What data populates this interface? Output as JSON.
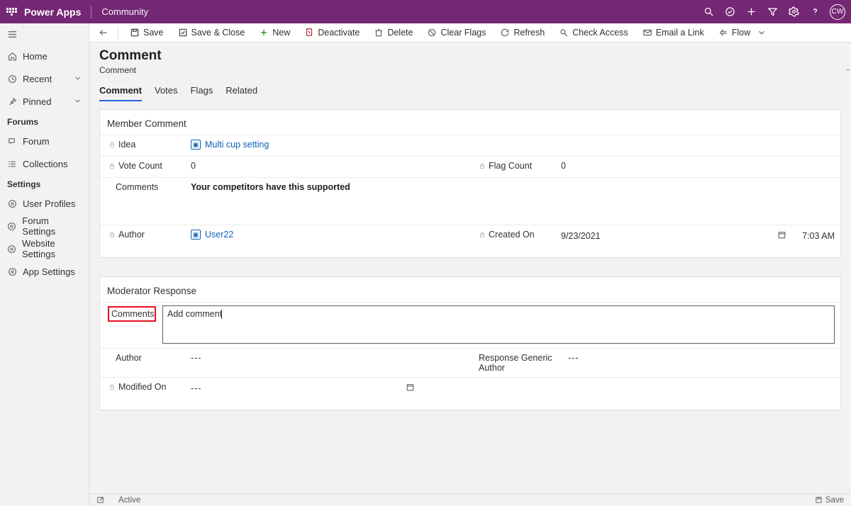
{
  "topbar": {
    "app": "Power Apps",
    "area": "Community",
    "avatar": "CW"
  },
  "sidebar": {
    "home": "Home",
    "recent": "Recent",
    "pinned": "Pinned",
    "group_forums": "Forums",
    "forum": "Forum",
    "collections": "Collections",
    "group_settings": "Settings",
    "user_profiles": "User Profiles",
    "forum_settings": "Forum Settings",
    "website_settings": "Website Settings",
    "app_settings": "App Settings"
  },
  "commands": {
    "save": "Save",
    "save_close": "Save & Close",
    "new": "New",
    "deactivate": "Deactivate",
    "delete": "Delete",
    "clear_flags": "Clear Flags",
    "refresh": "Refresh",
    "check_access": "Check Access",
    "email_link": "Email a Link",
    "flow": "Flow"
  },
  "header": {
    "title": "Comment",
    "subtitle": "Comment"
  },
  "tabs": {
    "comment": "Comment",
    "votes": "Votes",
    "flags": "Flags",
    "related": "Related"
  },
  "member": {
    "title": "Member Comment",
    "idea_label": "Idea",
    "idea_value": "Multi cup setting",
    "votecount_label": "Vote Count",
    "votecount_value": "0",
    "flagcount_label": "Flag Count",
    "flagcount_value": "0",
    "comments_label": "Comments",
    "comments_value": "Your competitors have this supported",
    "author_label": "Author",
    "author_value": "User22",
    "created_label": "Created On",
    "created_date": "9/23/2021",
    "created_time": "7:03 AM"
  },
  "moderator": {
    "title": "Moderator Response",
    "comments_label": "Comments",
    "comments_value": "Add comment",
    "author_label": "Author",
    "author_value": "---",
    "generic_label": "Response Generic Author",
    "generic_value": "---",
    "modified_label": "Modified On",
    "modified_value": "---"
  },
  "status": {
    "state": "Active",
    "save": "Save"
  }
}
